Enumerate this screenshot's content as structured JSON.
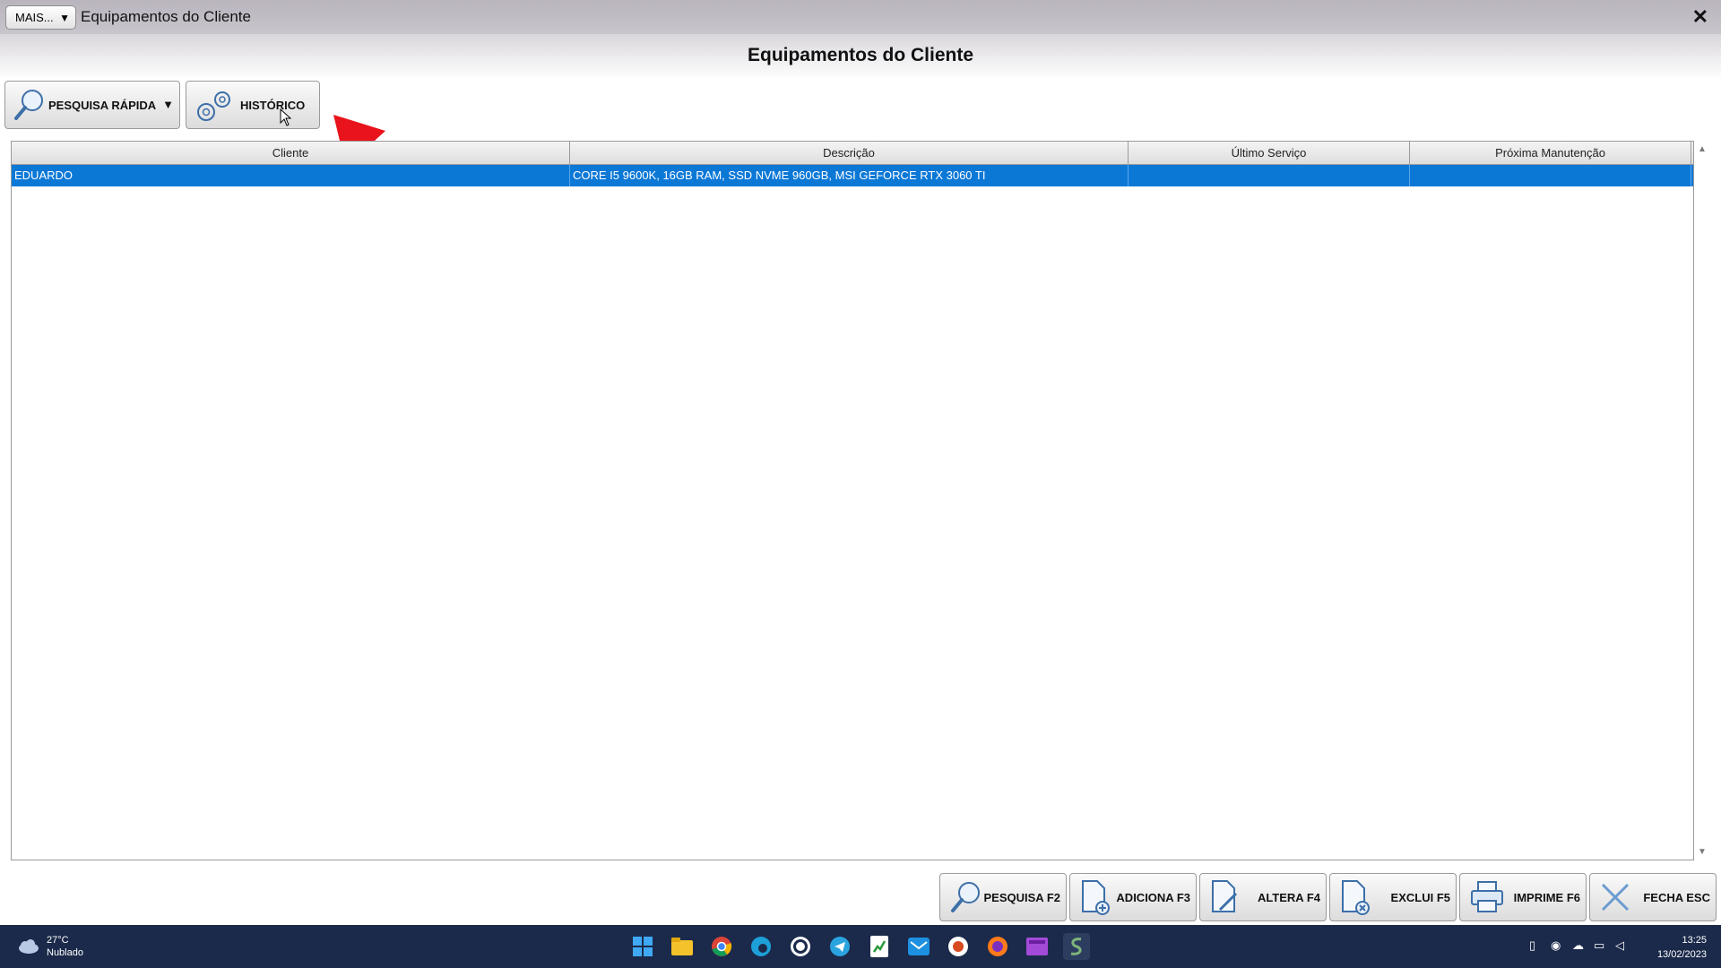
{
  "window": {
    "more_label": "MAIS...",
    "title": "Equipamentos do Cliente",
    "close": "✕"
  },
  "page": {
    "heading": "Equipamentos do Cliente"
  },
  "toolbar": {
    "quick_search": "PESQUISA RÁPIDA",
    "history": "HISTÓRICO"
  },
  "grid": {
    "columns": [
      "Cliente",
      "Descrição",
      "Último Serviço",
      "Próxima Manutenção"
    ],
    "rows": [
      [
        "EDUARDO",
        "CORE I5 9600K, 16GB RAM, SSD NVME 960GB, MSI GEFORCE RTX 3060 TI",
        "",
        ""
      ]
    ]
  },
  "actions": {
    "search": "PESQUISA F2",
    "add": "ADICIONA F3",
    "edit": "ALTERA F4",
    "delete": "EXCLUI F5",
    "print": "IMPRIME F6",
    "close": "FECHA ESC"
  },
  "taskbar": {
    "temperature": "27°C",
    "condition": "Nublado",
    "time": "13:25",
    "date": "13/02/2023"
  },
  "colors": {
    "selection": "#0c78d6",
    "arrow": "#e8131b",
    "taskbar": "#1b2a4a"
  }
}
